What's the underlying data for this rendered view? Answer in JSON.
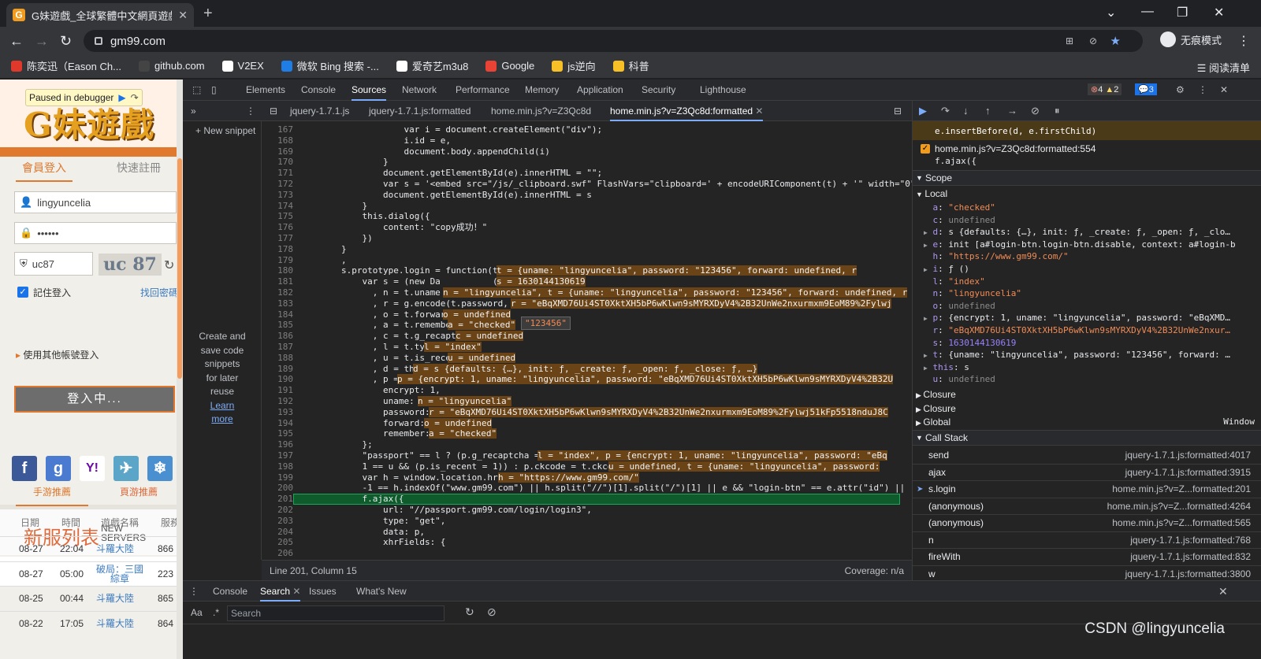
{
  "browser": {
    "tab_title": "G妹遊戲_全球繁體中文網頁遊戲",
    "url": "gm99.com",
    "incognito_label": "无痕模式",
    "reading_list": "阅读清单",
    "bookmarks": [
      {
        "label": "陈奕迅（Eason Ch...",
        "color": "#e0392b"
      },
      {
        "label": "github.com",
        "color": "#444"
      },
      {
        "label": "V2EX",
        "color": "#fff"
      },
      {
        "label": "微软 Bing 搜索 -...",
        "color": "#1f7de6"
      },
      {
        "label": "爱奇艺m3u8",
        "color": "#fff"
      },
      {
        "label": "Google",
        "color": "#ea4335"
      },
      {
        "label": "js逆向",
        "color": "#f6c026"
      },
      {
        "label": "科普",
        "color": "#f6c026"
      }
    ]
  },
  "page": {
    "paused_label": "Paused in debugger",
    "logo_text": "G妹遊戲",
    "tab_login": "會員登入",
    "tab_register": "快速註冊",
    "username": "lingyuncelia",
    "password_mask": "••••••",
    "captcha_input": "uc87",
    "captcha_image_text": "uc 87",
    "remember_label": "記住登入",
    "forgot_label": "找回密碼",
    "login_button": "登入中...",
    "other_login": "使用其他帳號登入",
    "social_icons": [
      "f",
      "g",
      "Y!",
      "✈",
      "❄"
    ],
    "servers_title": "新服列表",
    "servers_en1": "NEW",
    "servers_en2": "SERVERS",
    "tab_mobile": "手游推薦",
    "tab_web": "頁游推薦",
    "table_headers": [
      "日期",
      "時間",
      "遊戲名稱",
      "服務"
    ],
    "table_rows": [
      {
        "date": "08-27",
        "time": "22:04",
        "game": "斗羅大陸",
        "srv": "866"
      },
      {
        "date": "08-27",
        "time": "05:00",
        "game": "破局：三國\n綜章",
        "srv": "223"
      },
      {
        "date": "08-25",
        "time": "00:44",
        "game": "斗羅大陸",
        "srv": "865"
      },
      {
        "date": "08-22",
        "time": "17:05",
        "game": "斗羅大陸",
        "srv": "864"
      }
    ]
  },
  "devtools": {
    "tabs": [
      "Elements",
      "Console",
      "Sources",
      "Network",
      "Performance",
      "Memory",
      "Application",
      "Security",
      "Lighthouse"
    ],
    "active_tab": "Sources",
    "badge_errors": "4",
    "badge_warnings": "2",
    "badge_info": "3",
    "file_tabs": [
      "jquery-1.7.1.js",
      "jquery-1.7.1.js:formatted",
      "home.min.js?v=Z3Qc8d",
      "home.min.js?v=Z3Qc8d:formatted"
    ],
    "new_snippet": "+ New snippet",
    "snippet_msg": "Create and save code snippets for later reuse",
    "learn_more": "Learn more",
    "status_position": "Line 201, Column 15",
    "status_coverage": "Coverage: n/a",
    "tooltip": "\"123456\"",
    "code_lines": [
      {
        "n": "167",
        "t": "                    var i = document.createElement(\"div\");"
      },
      {
        "n": "168",
        "t": "                    i.id = e,"
      },
      {
        "n": "169",
        "t": "                    document.body.appendChild(i)"
      },
      {
        "n": "170",
        "t": "                }"
      },
      {
        "n": "171",
        "t": "                document.getElementById(e).innerHTML = \"\";"
      },
      {
        "n": "172",
        "t": "                var s = '<embed src=\"/js/_clipboard.swf\" FlashVars=\"clipboard=' + encodeURIComponent(t) + '\" width=\"0\""
      },
      {
        "n": "173",
        "t": "                document.getElementById(e).innerHTML = s"
      },
      {
        "n": "174",
        "t": "            }"
      },
      {
        "n": "175",
        "t": "            this.dialog({"
      },
      {
        "n": "176",
        "t": "                content: \"copy成功！\""
      },
      {
        "n": "177",
        "t": "            })"
      },
      {
        "n": "178",
        "t": "        }"
      },
      {
        "n": "179",
        "t": "        ,"
      },
      {
        "n": "180",
        "t": "        s.prototype.login = function(t, e, i) {"
      },
      {
        "n": "181",
        "t": "            var s = (new Da          ()"
      },
      {
        "n": "182",
        "t": "              , n = t.uname"
      },
      {
        "n": "183",
        "t": "              , r = g.encode(t.password, s)"
      },
      {
        "n": "184",
        "t": "              , o = t.forward"
      },
      {
        "n": "185",
        "t": "              , a = t.remember"
      },
      {
        "n": "186",
        "t": "              , c = t.g_recaptcha"
      },
      {
        "n": "187",
        "t": "              , l = t.type"
      },
      {
        "n": "188",
        "t": "              , u = t.is_recent"
      },
      {
        "n": "189",
        "t": "              , d = this"
      },
      {
        "n": "190",
        "t": "              , p = {"
      },
      {
        "n": "191",
        "t": "                encrypt: 1,"
      },
      {
        "n": "192",
        "t": "                uname: n,"
      },
      {
        "n": "193",
        "t": "                password: r,"
      },
      {
        "n": "194",
        "t": "                forward: o,"
      },
      {
        "n": "195",
        "t": "                remember: a"
      },
      {
        "n": "196",
        "t": "            };"
      },
      {
        "n": "197",
        "t": "            \"passport\" == l ? (p.g_recaptcha = c,"
      },
      {
        "n": "198",
        "t": "            1 == u && (p.is_recent = 1)) : p.ckcode = t.ckcode;"
      },
      {
        "n": "199",
        "t": "            var h = window.location.href;"
      },
      {
        "n": "200",
        "t": "            -1 == h.indexOf(\"www.gm99.com\") || h.split(\"//\")[1].split(\"/\")[1] || e && \"login-btn\" == e.attr(\"id\") || (p"
      },
      {
        "n": "201",
        "t": "            f.ajax({"
      },
      {
        "n": "202",
        "t": "                url: \"//passport.gm99.com/login/login3\","
      },
      {
        "n": "203",
        "t": "                type: \"get\","
      },
      {
        "n": "204",
        "t": "                data: p,"
      },
      {
        "n": "205",
        "t": "                xhrFields: {"
      },
      {
        "n": "206",
        "t": ""
      }
    ],
    "evals": [
      {
        "line": 13,
        "col": 250,
        "t": "t = {uname: \"lingyuncelia\", password: \"123456\", forward: undefined, r"
      },
      {
        "line": 14,
        "col": 250,
        "t": "s = 1630144130619"
      },
      {
        "line": 15,
        "col": 182,
        "t": "n = \"lingyuncelia\", t = {uname: \"lingyuncelia\", password: \"123456\", forward: undefined, r"
      },
      {
        "line": 16,
        "col": 268,
        "t": "r = \"eBqXMD76Ui4ST0XktXH5bP6wKlwn9sMYRXDyV4%2B32UnWe2nxurmxm9EoM89%2Fylwj"
      },
      {
        "line": 17,
        "col": 182,
        "t": "o = undefined"
      },
      {
        "line": 18,
        "col": 188,
        "t": "a = \"checked\""
      },
      {
        "line": 19,
        "col": 198,
        "t": "c = undefined"
      },
      {
        "line": 20,
        "col": 158,
        "t": "l = \"index\""
      },
      {
        "line": 21,
        "col": 188,
        "t": "u = undefined"
      },
      {
        "line": 22,
        "col": 144,
        "t": "d = s {defaults: {…}, init: ƒ, _create: ƒ, _open: ƒ, _close: ƒ, …}"
      },
      {
        "line": 23,
        "col": 124,
        "t": "p = {encrypt: 1, uname: \"lingyuncelia\", password: \"eBqXMD76Ui4ST0XktXH5bP6wKlwn9sMYRXDyV4%2B32U"
      },
      {
        "line": 25,
        "col": 150,
        "t": "n = \"lingyuncelia\""
      },
      {
        "line": 26,
        "col": 164,
        "t": "r = \"eBqXMD76Ui4ST0XktXH5bP6wKlwn9sMYRXDyV4%2B32UnWe2nxurmxm9EoM89%2Fylwj51kFp5518nduJ8C"
      },
      {
        "line": 27,
        "col": 158,
        "t": "o = undefined"
      },
      {
        "line": 28,
        "col": 164,
        "t": "a = \"checked\""
      },
      {
        "line": 30,
        "col": 302,
        "t": "l = \"index\", p = {encrypt: 1, uname: \"lingyuncelia\", password: \"eBq"
      },
      {
        "line": 31,
        "col": 392,
        "t": "u = undefined, t = {uname: \"lingyuncelia\", password:"
      },
      {
        "line": 32,
        "col": 252,
        "t": "h = \"https://www.gm99.com/\""
      }
    ],
    "breakpoints": [
      {
        "code": "e.insertBefore(d, e.firstChild)"
      },
      {
        "file": "home.min.js?v=Z3Qc8d:formatted:554",
        "code": "f.ajax({"
      }
    ],
    "scope_label": "Scope",
    "local_label": "Local",
    "scope_vars": [
      {
        "k": "a",
        "v": "\"checked\"",
        "c": "s"
      },
      {
        "k": "c",
        "v": "undefined",
        "c": "u"
      },
      {
        "k": "d",
        "v": "s {defaults: {…}, init: ƒ, _create: ƒ, _open: ƒ, _clo…",
        "c": "x",
        "exp": true
      },
      {
        "k": "e",
        "v": "init [a#login-btn.login-btn.disable, context: a#login-b",
        "c": "x",
        "exp": true
      },
      {
        "k": "h",
        "v": "\"https://www.gm99.com/\"",
        "c": "s"
      },
      {
        "k": "i",
        "v": "ƒ ()",
        "c": "x",
        "exp": true
      },
      {
        "k": "l",
        "v": "\"index\"",
        "c": "s"
      },
      {
        "k": "n",
        "v": "\"lingyuncelia\"",
        "c": "s"
      },
      {
        "k": "o",
        "v": "undefined",
        "c": "u"
      },
      {
        "k": "p",
        "v": "{encrypt: 1, uname: \"lingyuncelia\", password: \"eBqXMD…",
        "c": "x",
        "exp": true
      },
      {
        "k": "r",
        "v": "\"eBqXMD76Ui4ST0XktXH5bP6wKlwn9sMYRXDyV4%2B32UnWe2nxur…",
        "c": "s"
      },
      {
        "k": "s",
        "v": "1630144130619",
        "c": "n"
      },
      {
        "k": "t",
        "v": "{uname: \"lingyuncelia\", password: \"123456\", forward: …",
        "c": "x",
        "exp": true
      },
      {
        "k": "this",
        "v": "s",
        "c": "x",
        "exp": true
      },
      {
        "k": "u",
        "v": "undefined",
        "c": "u"
      }
    ],
    "closure1": "Closure",
    "closure2": "Closure",
    "global": "Global",
    "global_val": "Window",
    "callstack_label": "Call Stack",
    "callstack": [
      {
        "name": "send",
        "loc": "jquery-1.7.1.js:formatted:4017"
      },
      {
        "name": "ajax",
        "loc": "jquery-1.7.1.js:formatted:3915"
      },
      {
        "name": "s.login",
        "loc": "home.min.js?v=Z...formatted:201",
        "current": true
      },
      {
        "name": "(anonymous)",
        "loc": "home.min.js?v=Z...formatted:4264"
      },
      {
        "name": "(anonymous)",
        "loc": "home.min.js?v=Z...formatted:565"
      },
      {
        "name": "n",
        "loc": "jquery-1.7.1.js:formatted:768"
      },
      {
        "name": "fireWith",
        "loc": "jquery-1.7.1.js:formatted:832"
      },
      {
        "name": "w",
        "loc": "jquery-1.7.1.js:formatted:3800"
      }
    ],
    "drawer_tabs": [
      "Console",
      "Search",
      "Issues",
      "What's New"
    ],
    "drawer_active": "Search",
    "search_placeholder": "Search",
    "search_aa": "Aa"
  },
  "watermark": "CSDN @lingyuncelia"
}
